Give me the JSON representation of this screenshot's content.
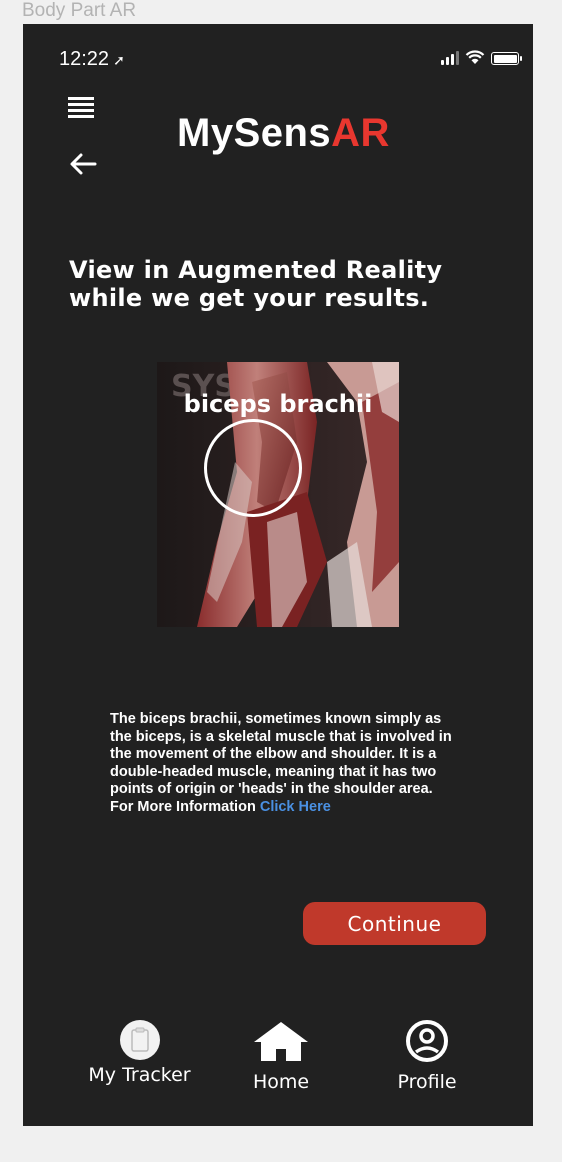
{
  "frame_label": "Body Part AR",
  "status_bar": {
    "time": "12:22",
    "location_arrow": "➚"
  },
  "header": {
    "logo_main": "MySens",
    "logo_accent": "AR",
    "accent_color": "#e8372f"
  },
  "headline": "View in Augmented Reality while we get your results.",
  "ar_view": {
    "label": "biceps brachii"
  },
  "description": {
    "text": "The biceps brachii, sometimes known simply as the biceps, is a skeletal muscle that is involved in the movement of the elbow and shoulder. It is a double-headed muscle, meaning that it has two points of origin or 'heads' in the shoulder area.",
    "more_prefix": "For More Information ",
    "link_text": "Click Here",
    "link_color": "#4a90e2"
  },
  "continue_button": {
    "label": "Continue",
    "color": "#c0392b"
  },
  "bottom_nav": {
    "items": [
      {
        "label": "My Tracker",
        "icon": "tracker-icon"
      },
      {
        "label": "Home",
        "icon": "home-icon"
      },
      {
        "label": "Profile",
        "icon": "profile-icon"
      }
    ]
  }
}
